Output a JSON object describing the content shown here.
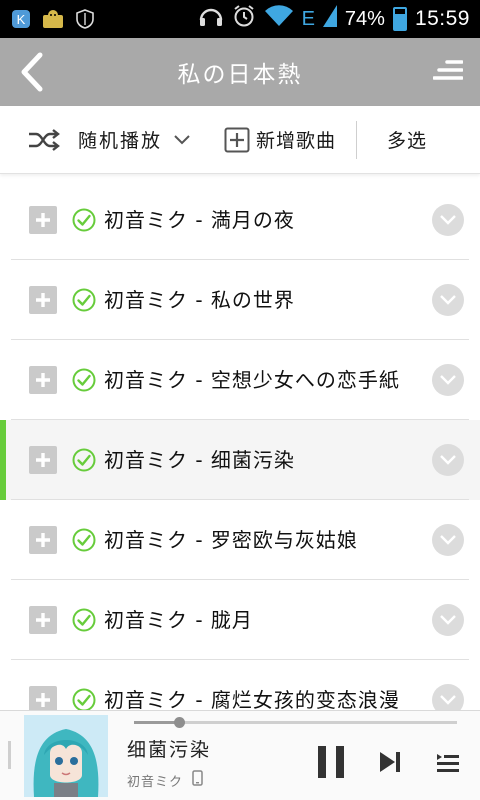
{
  "status_bar": {
    "icons_left": [
      "k-app-icon",
      "monkey-app-icon",
      "shield-icon"
    ],
    "icons_right": [
      "headphones-icon",
      "alarm-icon",
      "wifi-icon",
      "signal-icon",
      "battery-icon"
    ],
    "network_type": "E",
    "battery": "74%",
    "battery_level": 0.74,
    "time": "15:59"
  },
  "header": {
    "title": "私の日本熱"
  },
  "toolbar": {
    "shuffle_label": "随机播放",
    "add_label": "新增歌曲",
    "multi_label": "多选"
  },
  "colors": {
    "accent_green": "#67cc3b",
    "header_gray": "#a9a9a9"
  },
  "songs": [
    {
      "text": "初音ミク - 満月の夜",
      "active": false
    },
    {
      "text": "初音ミク - 私の世界",
      "active": false
    },
    {
      "text": "初音ミク - 空想少女への恋手紙",
      "active": false
    },
    {
      "text": "初音ミク - 细菌污染",
      "active": true
    },
    {
      "text": "初音ミク - 罗密欧与灰姑娘",
      "active": false
    },
    {
      "text": "初音ミク - 胧月",
      "active": false
    },
    {
      "text": "初音ミク - 腐烂女孩的变态浪漫",
      "active": false
    }
  ],
  "player": {
    "title": "细菌污染",
    "artist": "初音ミク",
    "progress": 0.14
  }
}
